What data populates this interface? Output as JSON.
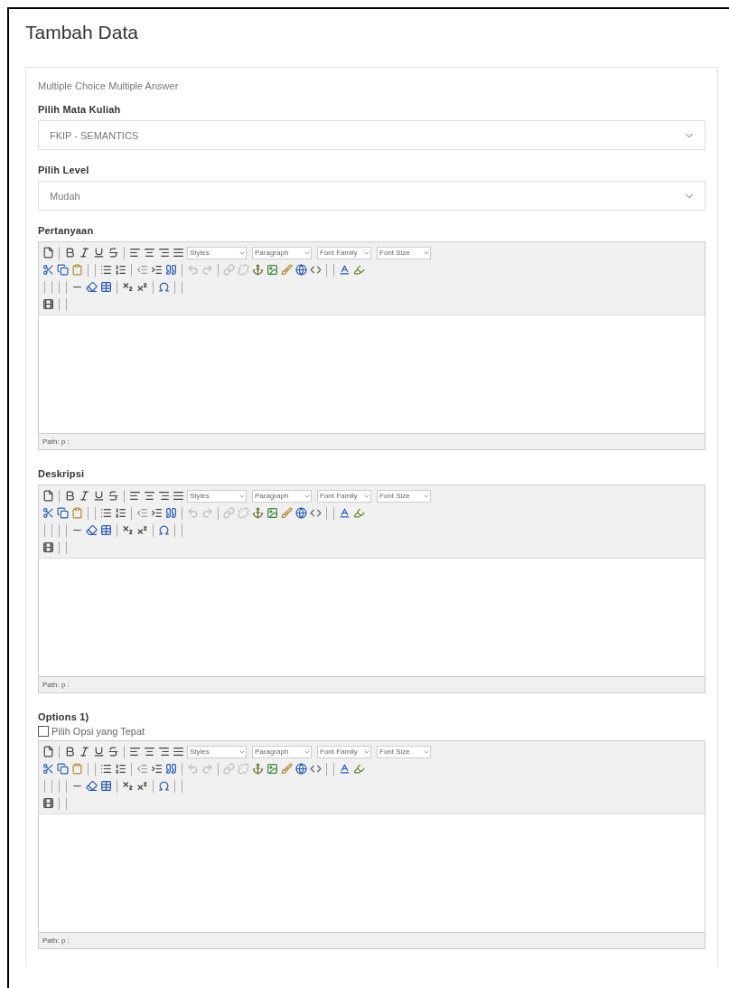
{
  "page": {
    "title": "Tambah Data"
  },
  "form": {
    "type_label": "Multiple Choice Multiple Answer",
    "selects": [
      {
        "label": "Pilih Mata Kuliah",
        "value": "FKIP - SEMANTICS"
      },
      {
        "label": "Pilih Level",
        "value": "Mudah"
      }
    ],
    "editors": [
      {
        "label": "Pertanyaan",
        "toolbar_selects": [
          "Styles",
          "Paragraph",
          "Font Family",
          "Font Size"
        ],
        "path": "Path: p :"
      },
      {
        "label": "Deskripsi",
        "toolbar_selects": [
          "Styles",
          "Paragraph",
          "Font Family",
          "Font Size"
        ],
        "path": "Path: p :"
      },
      {
        "label": "Options 1)",
        "checkbox": {
          "label": "Pilih Opsi yang Tepat",
          "checked": false
        },
        "toolbar_selects": [
          "Styles",
          "Paragraph",
          "Font Family",
          "Font Size"
        ],
        "path": "Path: p :"
      }
    ]
  }
}
